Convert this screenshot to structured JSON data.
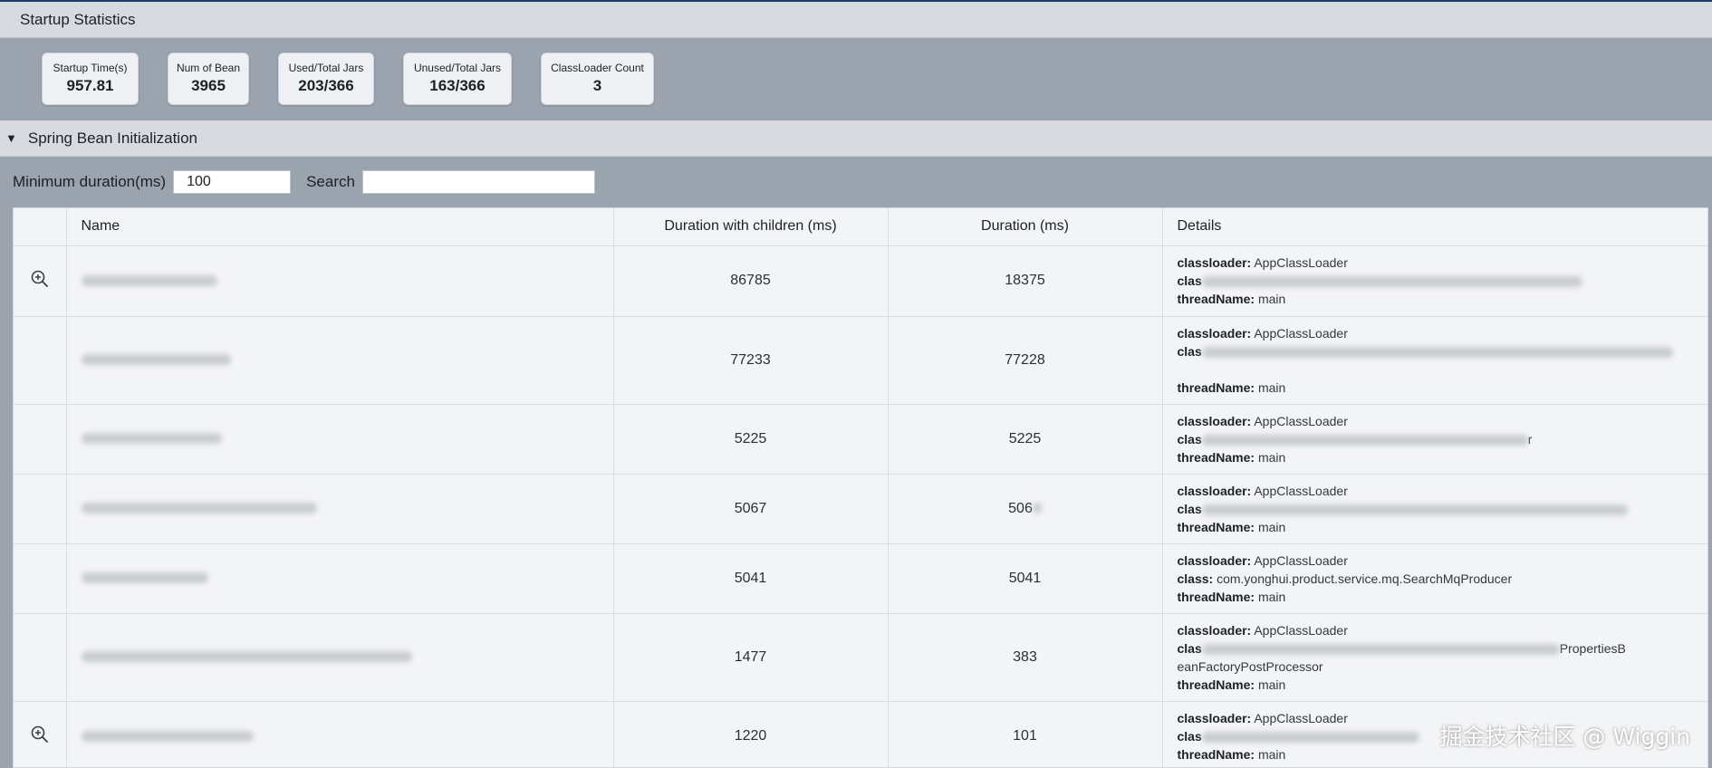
{
  "stats_section": {
    "title": "Startup Statistics"
  },
  "stats": [
    {
      "label": "Startup Time(s)",
      "value": "957.81"
    },
    {
      "label": "Num of Bean",
      "value": "3965"
    },
    {
      "label": "Used/Total Jars",
      "value": "203/366"
    },
    {
      "label": "Unused/Total Jars",
      "value": "163/366"
    },
    {
      "label": "ClassLoader Count",
      "value": "3"
    }
  ],
  "beans_section": {
    "title": "Spring Bean Initialization",
    "caret": "▼"
  },
  "filters": {
    "min_duration_label": "Minimum duration(ms)",
    "min_duration_value": "100",
    "search_label": "Search",
    "search_value": ""
  },
  "table": {
    "columns": [
      "",
      "Name",
      "Duration with children (ms)",
      "Duration (ms)",
      "Details"
    ],
    "detail_keys": {
      "classloader": "classloader:",
      "class": "clas",
      "thread": "threadName:"
    },
    "rows": [
      {
        "has_zoom": true,
        "duration_children": "86785",
        "duration": "18375",
        "classloader": "AppClassLoader",
        "class_text": "",
        "thread": "main"
      },
      {
        "has_zoom": false,
        "duration_children": "77233",
        "duration": "77228",
        "classloader": "AppClassLoader",
        "class_text": "",
        "thread": "main"
      },
      {
        "has_zoom": false,
        "duration_children": "5225",
        "duration": "5225",
        "classloader": "AppClassLoader",
        "class_text": "r",
        "thread": "main"
      },
      {
        "has_zoom": false,
        "duration_children": "5067",
        "duration": "506",
        "classloader": "AppClassLoader",
        "class_text": "",
        "thread": "main"
      },
      {
        "has_zoom": false,
        "duration_children": "5041",
        "duration": "5041",
        "classloader": "AppClassLoader",
        "class_text": "com.yonghui.product.service.mq.SearchMqProducer",
        "class_key_full": "class:",
        "thread": "main"
      },
      {
        "has_zoom": false,
        "duration_children": "1477",
        "duration": "383",
        "classloader": "AppClassLoader",
        "class_text": "PropertiesB",
        "class_wrap": "eanFactoryPostProcessor",
        "thread": "main"
      },
      {
        "has_zoom": true,
        "duration_children": "1220",
        "duration": "101",
        "classloader": "AppClassLoader",
        "class_text": "",
        "thread": "main"
      }
    ]
  },
  "watermark": "掘金技术社区 @ Wiggin",
  "colors": {
    "page_bg": "#9aa3ae",
    "bar_bg": "#d7dbe0",
    "table_bg": "#f3f4f6",
    "top_line": "#223a5e"
  },
  "icons": {
    "row_zoom": "zoom-in-icon"
  }
}
